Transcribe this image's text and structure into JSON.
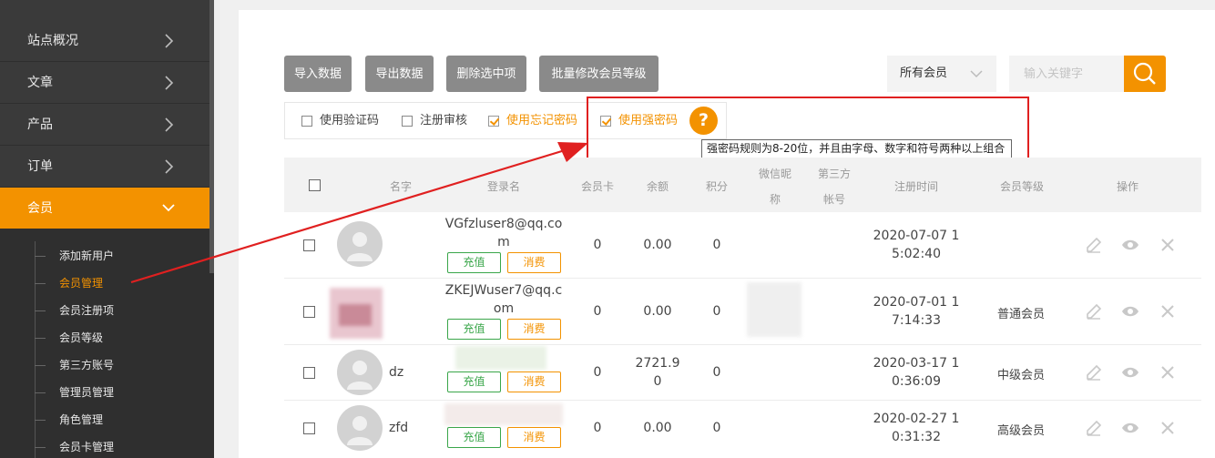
{
  "sidebar": {
    "nav": [
      "站点概况",
      "文章",
      "产品",
      "订单",
      "会员"
    ],
    "sub": [
      "添加新用户",
      "会员管理",
      "会员注册项",
      "会员等级",
      "第三方账号",
      "管理员管理",
      "角色管理",
      "会员卡管理"
    ]
  },
  "toolbar": {
    "import_label": "导入数据",
    "export_label": "导出数据",
    "delete_label": "删除选中项",
    "batch_label": "批量修改会员等级",
    "filter_value": "所有会员",
    "search_placeholder": "输入关键字"
  },
  "options": {
    "captcha": "使用验证码",
    "review": "注册审核",
    "forgot": "使用忘记密码",
    "strong": "使用强密码",
    "help_glyph": "?",
    "tooltip": "强密码规则为8-20位，并且由字母、数字和符号两种以上组合"
  },
  "table": {
    "headers": {
      "name": "名字",
      "login": "登录名",
      "card": "会员卡",
      "balance": "余额",
      "points": "积分",
      "wechat_1": "微信昵",
      "wechat_2": "称",
      "third_1": "第三方",
      "third_2": "帐号",
      "reg_time": "注册时间",
      "level": "会员等级",
      "actions": "操作"
    },
    "recharge_label": "充值",
    "consume_label": "消费",
    "rows": [
      {
        "name": "",
        "login_1": "VGfzluser8@qq.co",
        "login_2": "m",
        "card": "0",
        "balance_1": "0.00",
        "balance_2": "",
        "points": "0",
        "reg_1": "2020-07-07 1",
        "reg_2": "5:02:40",
        "level": ""
      },
      {
        "name": "",
        "login_1": "ZKEJWuser7@qq.c",
        "login_2": "om",
        "card": "0",
        "balance_1": "0.00",
        "balance_2": "",
        "points": "0",
        "reg_1": "2020-07-01 1",
        "reg_2": "7:14:33",
        "level": "普通会员"
      },
      {
        "name": "dz",
        "login_1": "",
        "login_2": "",
        "card": "0",
        "balance_1": "2721.9",
        "balance_2": "0",
        "points": "0",
        "reg_1": "2020-03-17 1",
        "reg_2": "0:36:09",
        "level": "中级会员"
      },
      {
        "name": "zfd",
        "login_1": "",
        "login_2": "",
        "card": "0",
        "balance_1": "0.00",
        "balance_2": "",
        "points": "0",
        "reg_1": "2020-02-27 1",
        "reg_2": "0:31:32",
        "level": "高级会员"
      }
    ]
  },
  "colors": {
    "accent": "#f39200",
    "sidebar": "#3a3a3a",
    "annotation": "#e02020",
    "green": "#3aa64a"
  }
}
